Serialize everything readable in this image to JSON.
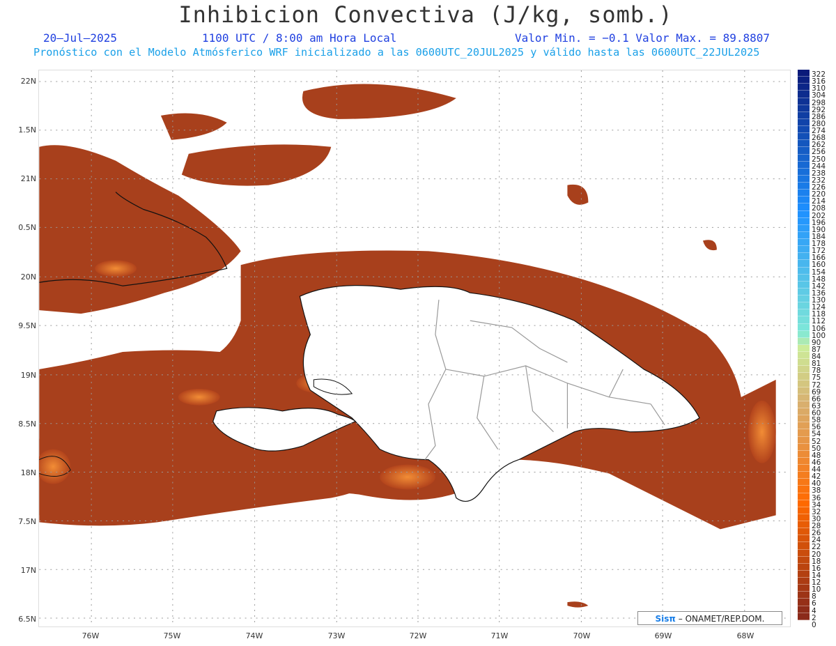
{
  "header": {
    "title": "Inhibicion Convectiva (J/kg, somb.)",
    "date": "20–Jul–2025",
    "time": "1100 UTC / 8:00 am Hora Local",
    "minmax": "Valor Min. = −0.1  Valor Max. = 89.8807",
    "forecast": "Pronóstico con el Modelo Atmósferico WRF inicializado a las 0600UTC_20JUL2025 y válido hasta las  0600UTC_22JUL2025"
  },
  "axes": {
    "lat_labels": [
      "22N",
      "1.5N",
      "21N",
      "0.5N",
      "20N",
      "9.5N",
      "19N",
      "8.5N",
      "18N",
      "7.5N",
      "17N",
      "6.5N"
    ],
    "lon_labels": [
      "76W",
      "75W",
      "74W",
      "73W",
      "72W",
      "71W",
      "70W",
      "69W",
      "68W"
    ]
  },
  "colorbar": {
    "labels": [
      "322",
      "316",
      "310",
      "304",
      "298",
      "292",
      "286",
      "280",
      "274",
      "268",
      "262",
      "256",
      "250",
      "244",
      "238",
      "232",
      "226",
      "220",
      "214",
      "208",
      "202",
      "196",
      "190",
      "184",
      "178",
      "172",
      "166",
      "160",
      "154",
      "148",
      "142",
      "136",
      "130",
      "124",
      "118",
      "112",
      "106",
      "100",
      "90",
      "87",
      "84",
      "81",
      "78",
      "75",
      "72",
      "69",
      "66",
      "63",
      "60",
      "58",
      "56",
      "54",
      "52",
      "50",
      "48",
      "46",
      "44",
      "42",
      "40",
      "38",
      "36",
      "34",
      "32",
      "30",
      "28",
      "26",
      "24",
      "22",
      "20",
      "18",
      "16",
      "14",
      "12",
      "10",
      "8",
      "6",
      "4",
      "2",
      "0"
    ],
    "colors": {
      "top": "#0a1a7a",
      "mid_blue": "#1e90ff",
      "cyan": "#7fe8d8",
      "yellow_green": "#ccec9a",
      "tan": "#d8b070",
      "orange": "#ff6a00",
      "dark_red": "#8b2a1a",
      "zero": "#ffffff"
    }
  },
  "map_colors": {
    "field_dark": "#a8401c",
    "field_mid": "#c45020",
    "field_bright": "#ff7a1a",
    "coast": "#111111",
    "borders": "#999999"
  },
  "credit": {
    "sis": "Sisπ",
    "rest": "– ONAMET/REP.DOM."
  }
}
